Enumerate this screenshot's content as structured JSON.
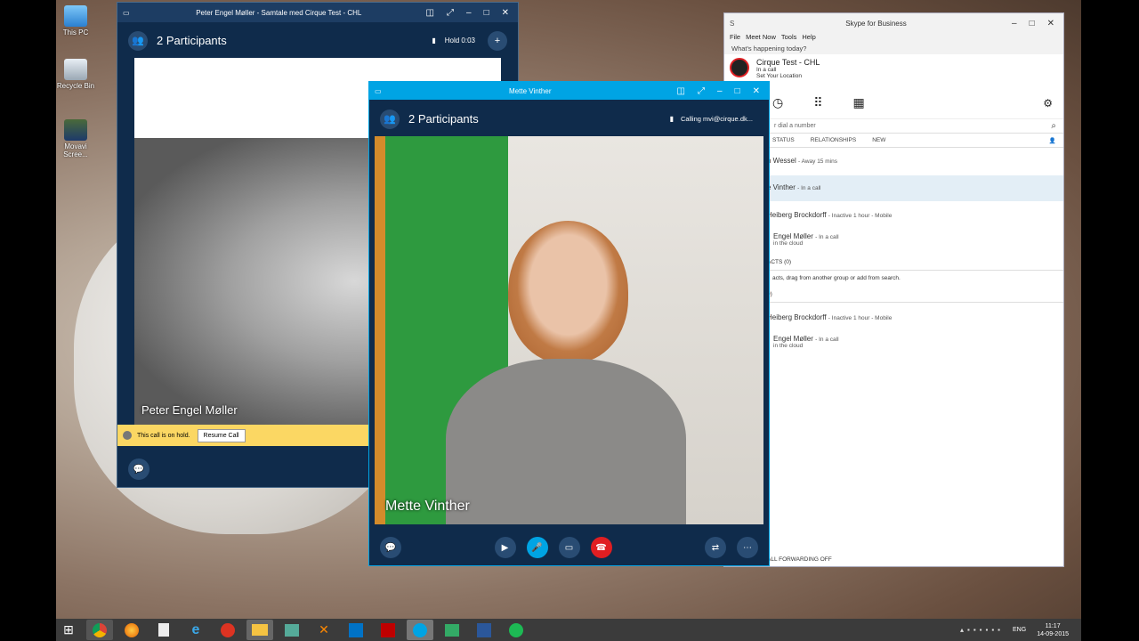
{
  "desktop": {
    "icons": [
      {
        "label": "This PC"
      },
      {
        "label": "Recycle Bin"
      },
      {
        "label": "Movavi Scree..."
      }
    ]
  },
  "win1": {
    "title": "Peter Engel Møller - Samtale med Cirque Test - CHL",
    "participants": "2 Participants",
    "status": "Hold 0:03",
    "caller_name": "Peter Engel Møller",
    "hold_notice": "This call is on hold.",
    "resume_label": "Resume Call"
  },
  "win2": {
    "title": "Mette Vinther",
    "participants": "2 Participants",
    "status": "Calling mvi@cirque.dk...",
    "caller_name": "Mette Vinther"
  },
  "skype": {
    "title": "Skype for Business",
    "menu": [
      "File",
      "Meet Now",
      "Tools",
      "Help"
    ],
    "whats_happening": "What's happening today?",
    "user_name": "Cirque Test - CHL",
    "user_status": "In a call",
    "location": "Set Your Location",
    "search_placeholder": "r dial a number",
    "tabs": [
      "STATUS",
      "RELATIONSHIPS",
      "NEW"
    ],
    "contacts": [
      {
        "name": "n Wessel",
        "status": "- Away 15 mins"
      },
      {
        "name": "e Vinther",
        "status": "- In a call"
      },
      {
        "name": "Heiberg Brockdorff",
        "status": "- Inactive 1 hour - Mobile"
      },
      {
        "name": "Engel Møller",
        "status": "- In a call",
        "sub": "in the cloud"
      },
      {
        "name": "ACTS (0)",
        "status": ""
      },
      {
        "name": "acts, drag from another group or add from search.",
        "status": ""
      },
      {
        "name": "0)",
        "status": ""
      },
      {
        "name": "Heiberg Brockdorff",
        "status": "- Inactive 1 hour - Mobile"
      },
      {
        "name": "Engel Møller",
        "status": "- In a call",
        "sub": "in the cloud"
      }
    ],
    "footer": "ALL FORWARDING OFF"
  },
  "clock": {
    "time": "11:17",
    "date": "14-09-2015",
    "lang": "ENG"
  },
  "colors": {
    "skype_blue": "#00a4e4",
    "navy": "#0f2b4b",
    "hangup": "#e01e22",
    "hold_yellow": "#fbd763"
  }
}
